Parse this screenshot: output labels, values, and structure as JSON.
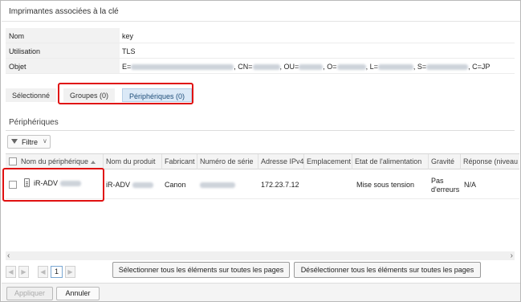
{
  "window": {
    "title": "Imprimantes associées à la clé"
  },
  "key_info": [
    {
      "label": "Nom",
      "value": "key"
    },
    {
      "label": "Utilisation",
      "value": "TLS"
    },
    {
      "label": "Objet",
      "parts": [
        "E=",
        ", CN=",
        ", OU=",
        ", O=",
        ", L=",
        ", S=",
        ", C=JP"
      ]
    }
  ],
  "tabs": {
    "selected": "Sélectionné",
    "groups": "Groupes (0)",
    "devices": "Périphériques (0)",
    "active": "devices"
  },
  "section_title": "Périphériques",
  "filter": {
    "label": "Filtre"
  },
  "table": {
    "columns": [
      "Nom du périphérique",
      "Nom du produit",
      "Fabricant",
      "Numéro de série",
      "Adresse IPv4",
      "Emplacement",
      "Etat de l'alimentation",
      "Gravité",
      "Réponse (niveau o"
    ],
    "rows": [
      {
        "device_name": "iR-ADV",
        "product_name": "iR-ADV",
        "manufacturer": "Canon",
        "serial": "",
        "ipv4": "172.23.7.12",
        "location": "",
        "power_state": "Mise sous tension",
        "severity": "Pas d'erreurs",
        "response": "N/A"
      }
    ]
  },
  "pager": {
    "current_page": "1"
  },
  "buttons": {
    "select_all": "Sélectionner tous les éléments sur toutes les pages",
    "deselect_all": "Désélectionner tous les éléments sur toutes les pages",
    "apply": "Appliquer",
    "cancel": "Annuler"
  },
  "colors": {
    "highlight": "#e01010",
    "active_tab": "#dbe9f7"
  }
}
